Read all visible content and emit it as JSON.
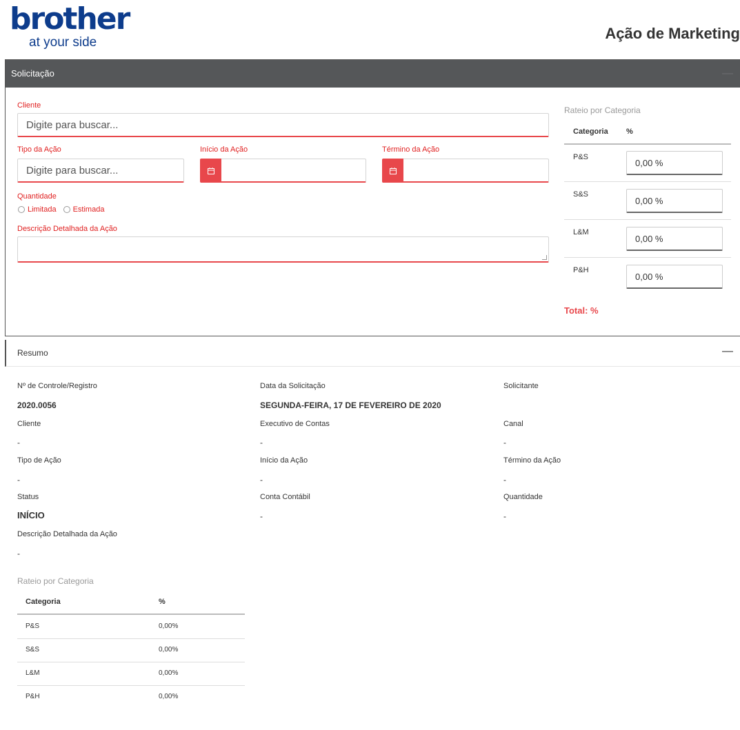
{
  "brand": {
    "name": "brother",
    "tagline": "at your side",
    "color": "#0d3c8c"
  },
  "page_title": "Ação de Marketing",
  "accent_color": "#e8474b",
  "solicitacao": {
    "title": "Solicitação",
    "collapse_icon": "minus-icon",
    "cliente_label": "Cliente",
    "cliente_placeholder": "Digite para buscar...",
    "tipo_label": "Tipo da Ação",
    "tipo_placeholder": "Digite para buscar...",
    "inicio_label": "Início da Ação",
    "termino_label": "Término da Ação",
    "date_icon": "calendar-icon",
    "quantidade_label": "Quantidade",
    "opt_limitada": "Limitada",
    "opt_estimada": "Estimada",
    "descricao_label": "Descrição Detalhada da Ação",
    "rateio": {
      "title": "Rateio por Categoria",
      "col_categoria": "Categoria",
      "col_pct": "%",
      "rows": [
        {
          "cat": "P&S",
          "value": "0,00 %"
        },
        {
          "cat": "S&S",
          "value": "0,00 %"
        },
        {
          "cat": "L&M",
          "value": "0,00 %"
        },
        {
          "cat": "P&H",
          "value": "0,00 %"
        }
      ],
      "total": "Total: %"
    }
  },
  "resumo": {
    "title": "Resumo",
    "collapse_icon": "minus-icon",
    "controle_label": "Nº de Controle/Registro",
    "controle_value": "2020.0056",
    "data_label": "Data da Solicitação",
    "data_value": "SEGUNDA-FEIRA, 17 DE FEVEREIRO DE 2020",
    "solicitante_label": "Solicitante",
    "cliente_label": "Cliente",
    "cliente_value": "-",
    "executivo_label": "Executivo de Contas",
    "executivo_value": "-",
    "canal_label": "Canal",
    "canal_value": "-",
    "tipo_label": "Tipo de Ação",
    "tipo_value": "-",
    "inicio_label": "Início da Ação",
    "inicio_value": "-",
    "termino_label": "Término da Ação",
    "termino_value": "-",
    "status_label": "Status",
    "status_value": "INÍCIO",
    "conta_label": "Conta Contábil",
    "conta_value": "-",
    "quantidade_label": "Quantidade",
    "quantidade_value": "-",
    "descricao_label": "Descrição Detalhada da Ação",
    "descricao_value": "-",
    "rateio": {
      "title": "Rateio por Categoria",
      "col_categoria": "Categoria",
      "col_pct": "%",
      "rows": [
        {
          "cat": "P&S",
          "value": "0,00%"
        },
        {
          "cat": "S&S",
          "value": "0,00%"
        },
        {
          "cat": "L&M",
          "value": "0,00%"
        },
        {
          "cat": "P&H",
          "value": "0,00%"
        }
      ]
    }
  }
}
